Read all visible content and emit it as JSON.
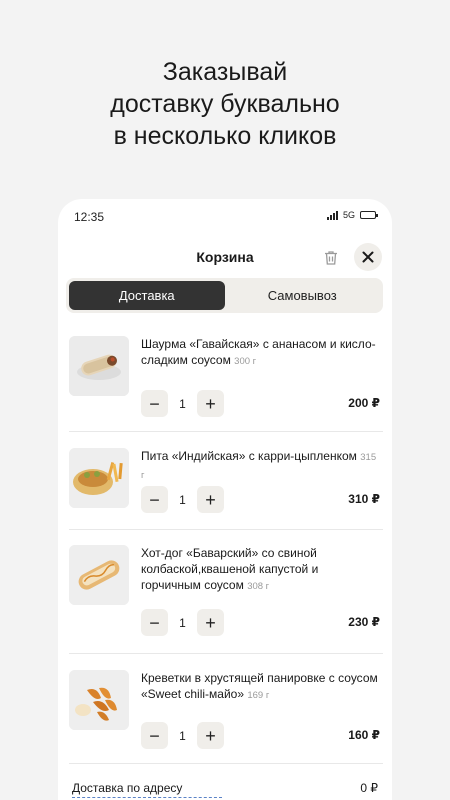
{
  "promo": {
    "line1": "Заказывай",
    "line2": "доставку буквально",
    "line3": "в несколько кликов"
  },
  "status_bar": {
    "time": "12:35",
    "network": "5G"
  },
  "header": {
    "title": "Корзина"
  },
  "tabs": [
    {
      "label": "Доставка",
      "active": true
    },
    {
      "label": "Самовывоз",
      "active": false
    }
  ],
  "items": [
    {
      "name": "Шаурма «Гавайская» с ананасом и кисло-сладким соусом",
      "weight": "300 г",
      "qty": "1",
      "price": "200 ₽"
    },
    {
      "name": "Пита «Индийская» с карри-цыпленком",
      "weight": "315 г",
      "qty": "1",
      "price": "310 ₽"
    },
    {
      "name": "Хот-дог «Баварский» со свиной колбаской,квашеной капустой и горчичным соусом",
      "weight": "308 г",
      "qty": "1",
      "price": "230 ₽"
    },
    {
      "name": "Креветки в хрустящей панировке с соусом «Sweet chili-майо»",
      "weight": "169 г",
      "qty": "1",
      "price": "160 ₽"
    }
  ],
  "footer": {
    "delivery_label": "Доставка по адресу",
    "delivery_price": "0 ₽"
  },
  "colors": {
    "accent_dark": "#333333",
    "chip_bg": "#f0eeea",
    "link": "#5b83c7"
  }
}
